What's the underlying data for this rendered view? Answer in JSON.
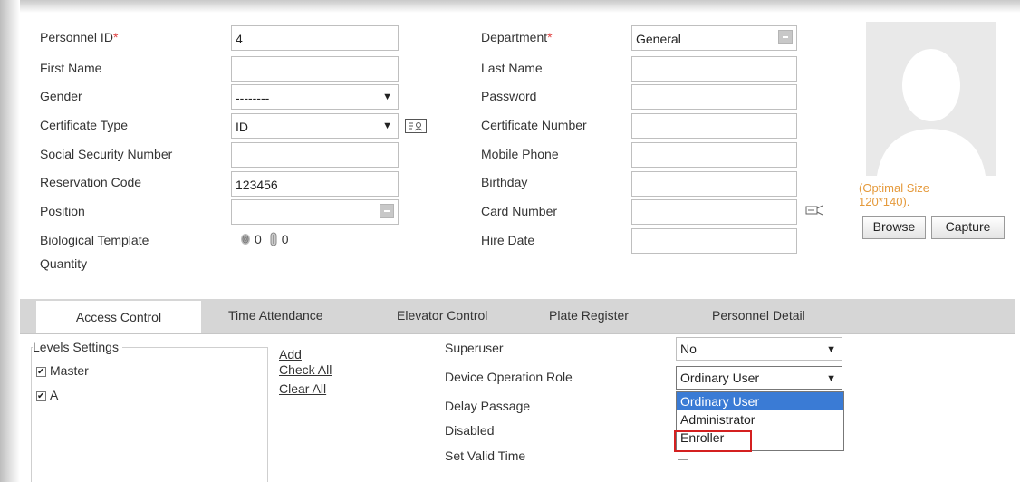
{
  "form": {
    "personnel_id": {
      "label": "Personnel ID",
      "req": "*",
      "value": "4"
    },
    "first_name": {
      "label": "First Name",
      "value": ""
    },
    "gender": {
      "label": "Gender",
      "value": "--------"
    },
    "certificate_type": {
      "label": "Certificate Type",
      "value": "ID"
    },
    "social_security": {
      "label": "Social Security Number",
      "value": ""
    },
    "reservation_code": {
      "label": "Reservation Code",
      "value": "123456"
    },
    "position": {
      "label": "Position",
      "value": ""
    },
    "bio_template": {
      "label_line1": "Biological Template",
      "label_line2": "Quantity",
      "fingerprint_count": "0",
      "finger_vein_count": "0"
    },
    "department": {
      "label": "Department",
      "req": "*",
      "value": "General"
    },
    "last_name": {
      "label": "Last Name",
      "value": ""
    },
    "password": {
      "label": "Password",
      "value": ""
    },
    "certificate_number": {
      "label": "Certificate Number",
      "value": ""
    },
    "mobile_phone": {
      "label": "Mobile Phone",
      "value": ""
    },
    "birthday": {
      "label": "Birthday",
      "value": ""
    },
    "card_number": {
      "label": "Card Number",
      "value": ""
    },
    "hire_date": {
      "label": "Hire Date",
      "value": ""
    }
  },
  "photo": {
    "hint_line1": "(Optimal Size",
    "hint_line2": "120*140).",
    "browse_label": "Browse",
    "capture_label": "Capture"
  },
  "tabs": [
    "Access Control",
    "Time Attendance",
    "Elevator Control",
    "Plate Register",
    "Personnel Detail"
  ],
  "access": {
    "levels_title": "Levels Settings",
    "levels": [
      "Master",
      "A"
    ],
    "add_link": "Add",
    "check_all_link": "Check All",
    "clear_all_link": "Clear All",
    "superuser_label": "Superuser",
    "superuser_value": "No",
    "device_role_label": "Device Operation Role",
    "device_role_value": "Ordinary User",
    "delay_passage_label": "Delay Passage",
    "disabled_label": "Disabled",
    "valid_time_label": "Set Valid Time",
    "role_options": [
      "Ordinary User",
      "Administrator",
      "Enroller"
    ]
  },
  "colors": {
    "highlight": "#3a7bd5",
    "annotation": "#d42020",
    "hint": "#e59a3c",
    "required": "#e04040"
  }
}
